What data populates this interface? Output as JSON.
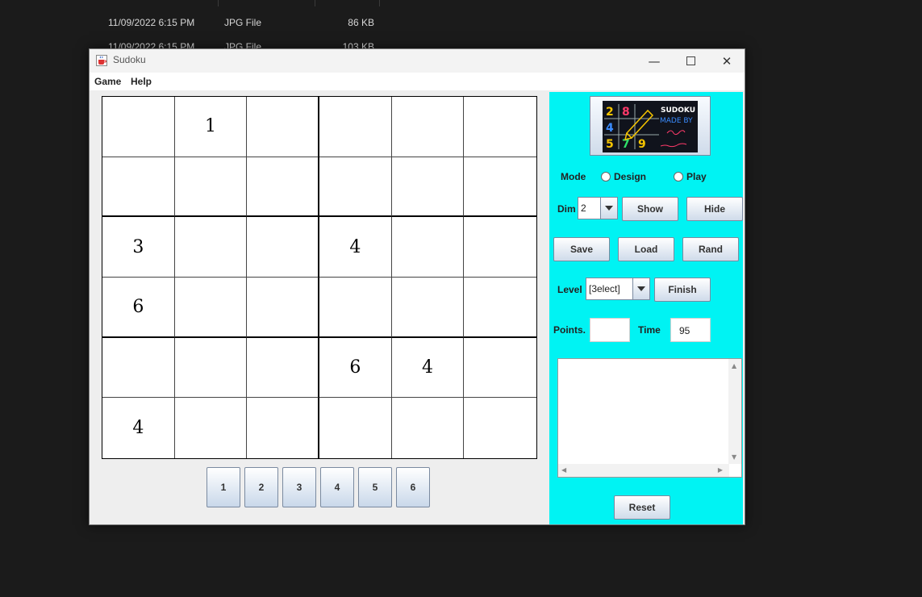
{
  "background_explorer": {
    "rows": [
      {
        "date": "11/09/2022 6:15 PM",
        "type": "JPG File",
        "size": "86 KB"
      },
      {
        "date": "11/09/2022 6:15 PM",
        "type": "JPG File",
        "size": "103 KB"
      }
    ]
  },
  "window": {
    "title": "Sudoku",
    "icon": "java-cup-icon",
    "controls": {
      "minimize": "—",
      "close": "✕"
    }
  },
  "menubar": {
    "game": "Game",
    "help": "Help"
  },
  "board": {
    "dimension": 6,
    "cells": [
      [
        "",
        "1",
        "",
        "",
        "",
        ""
      ],
      [
        "",
        "",
        "",
        "",
        "",
        ""
      ],
      [
        "3",
        "",
        "",
        "4",
        "",
        ""
      ],
      [
        "6",
        "",
        "",
        "",
        "",
        ""
      ],
      [
        "",
        "",
        "",
        "6",
        "4",
        ""
      ],
      [
        "4",
        "",
        "",
        "",
        "",
        ""
      ]
    ]
  },
  "numpad": [
    "1",
    "2",
    "3",
    "4",
    "5",
    "6"
  ],
  "panel": {
    "bg_color": "#00f3f3",
    "logo": {
      "icon": "sudoku-logo-icon",
      "digits": [
        "2",
        "8",
        "4",
        "5",
        "7",
        "9"
      ],
      "text_line1": "SUDOKU",
      "text_line2": "MADE BY"
    },
    "mode": {
      "label": "Mode",
      "design": "Design",
      "play": "Play"
    },
    "dim": {
      "label": "Dim",
      "value": "2",
      "show": "Show",
      "hide": "Hide"
    },
    "actions": {
      "save": "Save",
      "load": "Load",
      "rand": "Rand"
    },
    "level": {
      "label": "Level",
      "value": "[3elect]",
      "finish": "Finish"
    },
    "points": {
      "label": "Points.",
      "value": ""
    },
    "time": {
      "label": "Time",
      "value": "95"
    },
    "reset": "Reset"
  }
}
